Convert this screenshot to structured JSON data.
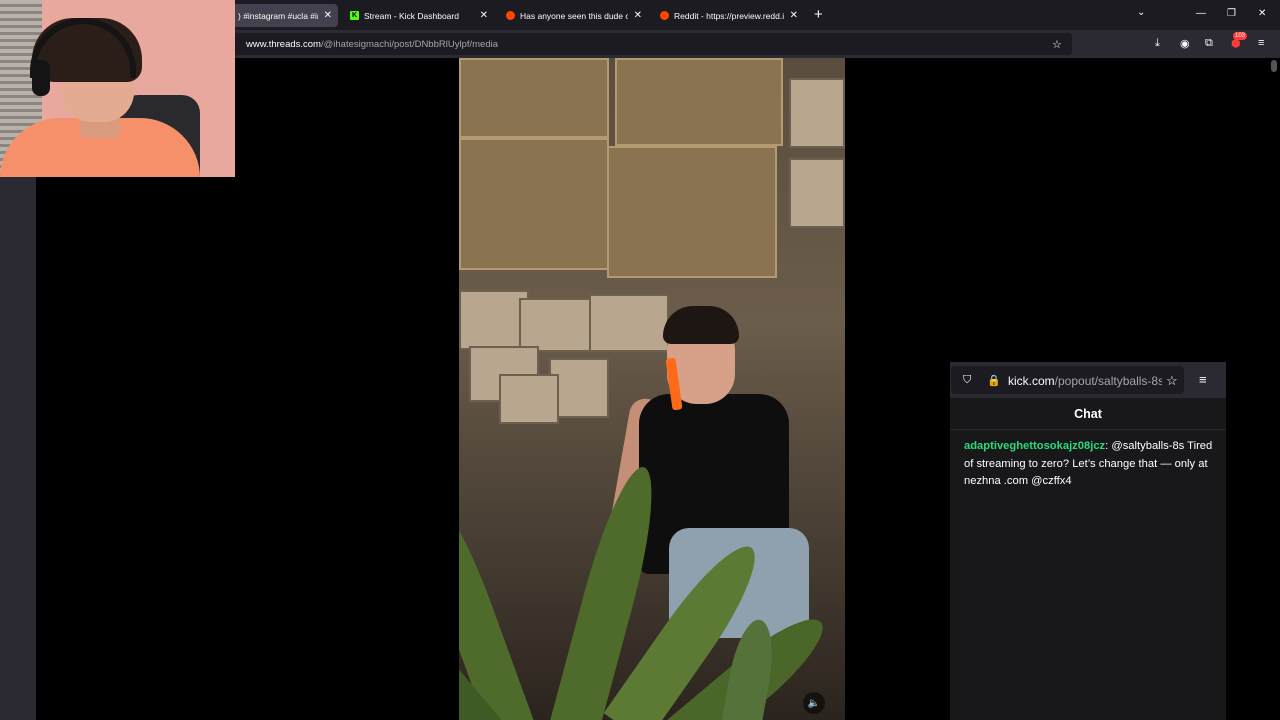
{
  "browser": {
    "tabs": [
      {
        "title": ") #instagram #ucla #ins",
        "favicon": "none",
        "active": true
      },
      {
        "title": "Stream - Kick Dashboard",
        "favicon": "kick-icon",
        "active": false
      },
      {
        "title": "Has anyone seen this dude on",
        "favicon": "reddit-icon",
        "active": false
      },
      {
        "title": "Reddit - https://preview.redd.it/",
        "favicon": "reddit-icon",
        "active": false
      }
    ],
    "new_tab_label": "+",
    "url_domain": "www.threads.com",
    "url_path": "/@ihatesigmachi/post/DNbbRlUylpf/media",
    "extensions_badge": "103"
  },
  "video": {
    "mute_icon": "speaker-icon"
  },
  "kick_popout": {
    "url_domain": "kick.com",
    "url_path": "/popout/saltyballs-8s",
    "chat_title": "Chat",
    "messages": [
      {
        "username": "adaptiveghettosokajz08jcz",
        "text": "@saltyballs-8s Tired of streaming to zero? Let’s change that — only at nezhna .com @czffx4",
        "username_color": "#2bd97b"
      }
    ]
  }
}
